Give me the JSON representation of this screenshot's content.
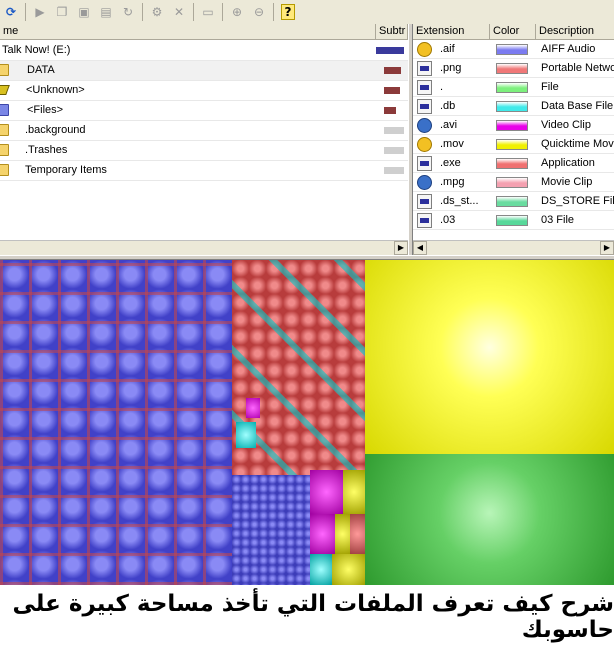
{
  "toolbar": {
    "buttons": [
      {
        "icon": "refresh-icon",
        "glyph": "⟳",
        "enabled": true
      },
      {
        "icon": "play-icon",
        "glyph": "▶",
        "enabled": false
      },
      {
        "icon": "copy-icon",
        "glyph": "❐",
        "enabled": false
      },
      {
        "icon": "explorer-icon",
        "glyph": "▣",
        "enabled": false
      },
      {
        "icon": "command-prompt-icon",
        "glyph": "▤",
        "enabled": false
      },
      {
        "icon": "refresh-selected-icon",
        "glyph": "↻",
        "enabled": false
      },
      {
        "icon": "recycle-icon",
        "glyph": "⚙",
        "enabled": false
      },
      {
        "icon": "delete-icon",
        "glyph": "✕",
        "enabled": false
      },
      {
        "icon": "new-folder-icon",
        "glyph": "▭",
        "enabled": false
      },
      {
        "icon": "zoom-in-icon",
        "glyph": "⊕",
        "enabled": false
      },
      {
        "icon": "zoom-out-icon",
        "glyph": "⊖",
        "enabled": false
      },
      {
        "icon": "help-icon",
        "glyph": "?",
        "enabled": true
      }
    ]
  },
  "tree": {
    "columns": {
      "name": "me",
      "subtree": "Subtr"
    },
    "rows": [
      {
        "label": "Talk Now! (E:)",
        "icon": "drive-root-icon",
        "subtree": 1.0,
        "bar_color": "#3a3a9c"
      },
      {
        "label": "DATA",
        "icon": "folder-icon",
        "subtree": 0.85,
        "bar_color": "#8b3a3a"
      },
      {
        "label": "<Unknown>",
        "icon": "drive-icon",
        "subtree": 0.8,
        "bar_color": "#8b3a3a"
      },
      {
        "label": "<Files>",
        "icon": "files-folder-icon",
        "subtree": 0.6,
        "bar_color": "#8b3a3a"
      },
      {
        "label": ".background",
        "icon": "folder-icon",
        "subtree": 0.0,
        "bar_color": "#cfcfcf"
      },
      {
        "label": ".Trashes",
        "icon": "folder-icon",
        "subtree": 0.0,
        "bar_color": "#cfcfcf"
      },
      {
        "label": "Temporary Items",
        "icon": "folder-icon",
        "subtree": 0.0,
        "bar_color": "#cfcfcf"
      }
    ]
  },
  "extensions": {
    "columns": {
      "extension": "Extension",
      "color": "Color",
      "description": "Description"
    },
    "rows": [
      {
        "ext": ".aif",
        "color": "#7b7bf0",
        "desc": "AIFF Audio",
        "icon": "audio-file-icon"
      },
      {
        "ext": ".png",
        "color": "#f07878",
        "desc": "Portable Network",
        "icon": "image-file-icon"
      },
      {
        "ext": ".",
        "color": "#7df07d",
        "desc": "File",
        "icon": "generic-file-icon"
      },
      {
        "ext": ".db",
        "color": "#3feaea",
        "desc": "Data Base File",
        "icon": "generic-file-icon"
      },
      {
        "ext": ".avi",
        "color": "#e800e8",
        "desc": "Video Clip",
        "icon": "video-file-icon"
      },
      {
        "ext": ".mov",
        "color": "#f0f000",
        "desc": "Quicktime Movie",
        "icon": "quicktime-file-icon"
      },
      {
        "ext": ".exe",
        "color": "#f07070",
        "desc": "Application",
        "icon": "application-file-icon"
      },
      {
        "ext": ".mpg",
        "color": "#f4a0b0",
        "desc": "Movie Clip",
        "icon": "media-file-icon"
      },
      {
        "ext": ".ds_st...",
        "color": "#6adca0",
        "desc": "DS_STORE File",
        "icon": "generic-file-icon"
      },
      {
        "ext": ".03",
        "color": "#58d89a",
        "desc": "03 File",
        "icon": "generic-file-icon"
      }
    ]
  },
  "caption": {
    "text": "شرح كيف تعرف الملفات التي تأخذ مساحة كبيرة على حاسوبك"
  }
}
